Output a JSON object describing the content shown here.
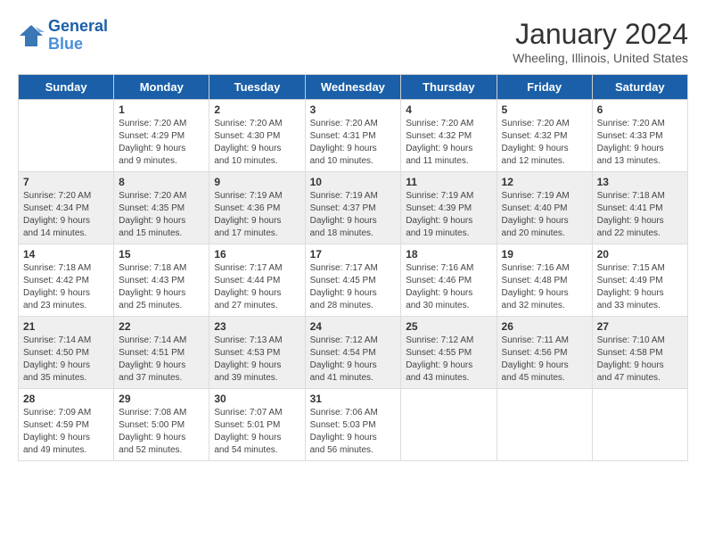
{
  "logo": {
    "line1": "General",
    "line2": "Blue"
  },
  "title": "January 2024",
  "subtitle": "Wheeling, Illinois, United States",
  "weekdays": [
    "Sunday",
    "Monday",
    "Tuesday",
    "Wednesday",
    "Thursday",
    "Friday",
    "Saturday"
  ],
  "weeks": [
    [
      {
        "day": "",
        "info": ""
      },
      {
        "day": "1",
        "info": "Sunrise: 7:20 AM\nSunset: 4:29 PM\nDaylight: 9 hours\nand 9 minutes."
      },
      {
        "day": "2",
        "info": "Sunrise: 7:20 AM\nSunset: 4:30 PM\nDaylight: 9 hours\nand 10 minutes."
      },
      {
        "day": "3",
        "info": "Sunrise: 7:20 AM\nSunset: 4:31 PM\nDaylight: 9 hours\nand 10 minutes."
      },
      {
        "day": "4",
        "info": "Sunrise: 7:20 AM\nSunset: 4:32 PM\nDaylight: 9 hours\nand 11 minutes."
      },
      {
        "day": "5",
        "info": "Sunrise: 7:20 AM\nSunset: 4:32 PM\nDaylight: 9 hours\nand 12 minutes."
      },
      {
        "day": "6",
        "info": "Sunrise: 7:20 AM\nSunset: 4:33 PM\nDaylight: 9 hours\nand 13 minutes."
      }
    ],
    [
      {
        "day": "7",
        "info": ""
      },
      {
        "day": "8",
        "info": "Sunrise: 7:20 AM\nSunset: 4:35 PM\nDaylight: 9 hours\nand 15 minutes."
      },
      {
        "day": "9",
        "info": "Sunrise: 7:19 AM\nSunset: 4:36 PM\nDaylight: 9 hours\nand 17 minutes."
      },
      {
        "day": "10",
        "info": "Sunrise: 7:19 AM\nSunset: 4:37 PM\nDaylight: 9 hours\nand 18 minutes."
      },
      {
        "day": "11",
        "info": "Sunrise: 7:19 AM\nSunset: 4:39 PM\nDaylight: 9 hours\nand 19 minutes."
      },
      {
        "day": "12",
        "info": "Sunrise: 7:19 AM\nSunset: 4:40 PM\nDaylight: 9 hours\nand 20 minutes."
      },
      {
        "day": "13",
        "info": "Sunrise: 7:18 AM\nSunset: 4:41 PM\nDaylight: 9 hours\nand 22 minutes."
      }
    ],
    [
      {
        "day": "14",
        "info": ""
      },
      {
        "day": "15",
        "info": "Sunrise: 7:18 AM\nSunset: 4:43 PM\nDaylight: 9 hours\nand 25 minutes."
      },
      {
        "day": "16",
        "info": "Sunrise: 7:17 AM\nSunset: 4:44 PM\nDaylight: 9 hours\nand 27 minutes."
      },
      {
        "day": "17",
        "info": "Sunrise: 7:17 AM\nSunset: 4:45 PM\nDaylight: 9 hours\nand 28 minutes."
      },
      {
        "day": "18",
        "info": "Sunrise: 7:16 AM\nSunset: 4:46 PM\nDaylight: 9 hours\nand 30 minutes."
      },
      {
        "day": "19",
        "info": "Sunrise: 7:16 AM\nSunset: 4:48 PM\nDaylight: 9 hours\nand 32 minutes."
      },
      {
        "day": "20",
        "info": "Sunrise: 7:15 AM\nSunset: 4:49 PM\nDaylight: 9 hours\nand 33 minutes."
      }
    ],
    [
      {
        "day": "21",
        "info": ""
      },
      {
        "day": "22",
        "info": "Sunrise: 7:14 AM\nSunset: 4:51 PM\nDaylight: 9 hours\nand 37 minutes."
      },
      {
        "day": "23",
        "info": "Sunrise: 7:13 AM\nSunset: 4:53 PM\nDaylight: 9 hours\nand 39 minutes."
      },
      {
        "day": "24",
        "info": "Sunrise: 7:12 AM\nSunset: 4:54 PM\nDaylight: 9 hours\nand 41 minutes."
      },
      {
        "day": "25",
        "info": "Sunrise: 7:12 AM\nSunset: 4:55 PM\nDaylight: 9 hours\nand 43 minutes."
      },
      {
        "day": "26",
        "info": "Sunrise: 7:11 AM\nSunset: 4:56 PM\nDaylight: 9 hours\nand 45 minutes."
      },
      {
        "day": "27",
        "info": "Sunrise: 7:10 AM\nSunset: 4:58 PM\nDaylight: 9 hours\nand 47 minutes."
      }
    ],
    [
      {
        "day": "28",
        "info": ""
      },
      {
        "day": "29",
        "info": "Sunrise: 7:08 AM\nSunset: 5:00 PM\nDaylight: 9 hours\nand 52 minutes."
      },
      {
        "day": "30",
        "info": "Sunrise: 7:07 AM\nSunset: 5:01 PM\nDaylight: 9 hours\nand 54 minutes."
      },
      {
        "day": "31",
        "info": "Sunrise: 7:06 AM\nSunset: 5:03 PM\nDaylight: 9 hours\nand 56 minutes."
      },
      {
        "day": "",
        "info": ""
      },
      {
        "day": "",
        "info": ""
      },
      {
        "day": "",
        "info": ""
      }
    ]
  ],
  "week1_sunday": "Sunrise: 7:20 AM\nSunset: 4:34 PM\nDaylight: 9 hours\nand 14 minutes.",
  "week3_sunday": "Sunrise: 7:18 AM\nSunset: 4:42 PM\nDaylight: 9 hours\nand 23 minutes.",
  "week4_sunday": "Sunrise: 7:14 AM\nSunset: 4:50 PM\nDaylight: 9 hours\nand 35 minutes.",
  "week5_sunday": "Sunrise: 7:09 AM\nSunset: 4:59 PM\nDaylight: 9 hours\nand 49 minutes."
}
